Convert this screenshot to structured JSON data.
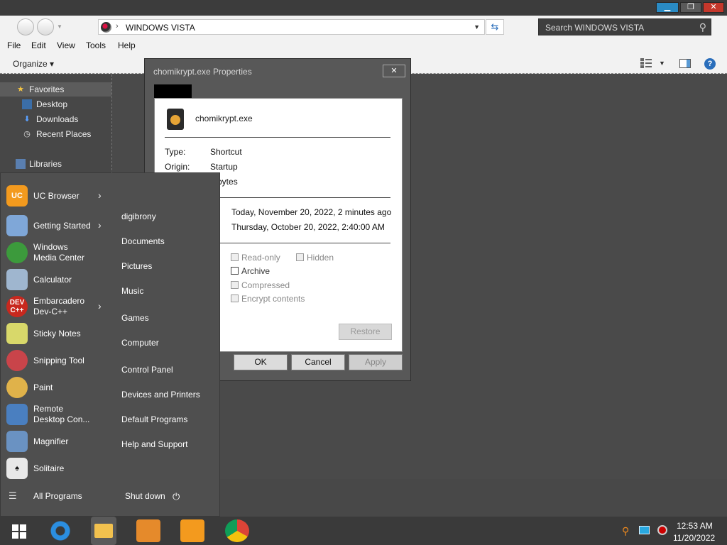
{
  "explorer": {
    "address_path": "WINDOWS VISTA",
    "search_placeholder": "Search WINDOWS VISTA",
    "menu": [
      "File",
      "Edit",
      "View",
      "Tools",
      "Help"
    ],
    "organize_label": "Organize",
    "nav": {
      "favorites": "Favorites",
      "desktop": "Desktop",
      "downloads": "Downloads",
      "recent_places": "Recent Places",
      "libraries": "Libraries"
    }
  },
  "dialog": {
    "title": "chomikrypt.exe Properties",
    "file_name": "chomikrypt.exe",
    "type_label": "Type:",
    "type_value": "Shortcut",
    "origin_label": "Origin:",
    "origin_value": "Startup",
    "size_value_partial": "9 bytes",
    "modified": "Today, November 20, 2022, 2 minutes ago",
    "accessed": "Thursday, October 20, 2022, 2:40:00 AM",
    "attributes": {
      "read_only": "Read-only",
      "hidden": "Hidden",
      "archive": "Archive",
      "compressed": "Compressed",
      "encrypt": "Encrypt contents"
    },
    "restore_label": "Restore",
    "ok_label": "OK",
    "cancel_label": "Cancel",
    "apply_label": "Apply"
  },
  "start_menu": {
    "apps": {
      "uc_browser": "UC Browser",
      "getting_started": "Getting Started",
      "media_center": "Windows\nMedia Center",
      "calculator": "Calculator",
      "devcpp": "Embarcadero\nDev-C++",
      "sticky_notes": "Sticky Notes",
      "snipping_tool": "Snipping Tool",
      "paint": "Paint",
      "remote_desktop": "Remote\nDesktop Con...",
      "magnifier": "Magnifier",
      "solitaire": "Solitaire"
    },
    "devcpp_icon_text": "DEV\nC++",
    "places": [
      "digibrony",
      "Documents",
      "Pictures",
      "Music",
      "Games",
      "Computer",
      "Control Panel",
      "Devices and Printers",
      "Default Programs",
      "Help and Support"
    ],
    "all_programs": "All Programs",
    "shut_down": "Shut down"
  },
  "taskbar": {
    "time": "12:53 AM",
    "date": "11/20/2022"
  },
  "colors": {
    "minimize_accent": "#2a8bc4",
    "close_red": "#c4372b"
  }
}
